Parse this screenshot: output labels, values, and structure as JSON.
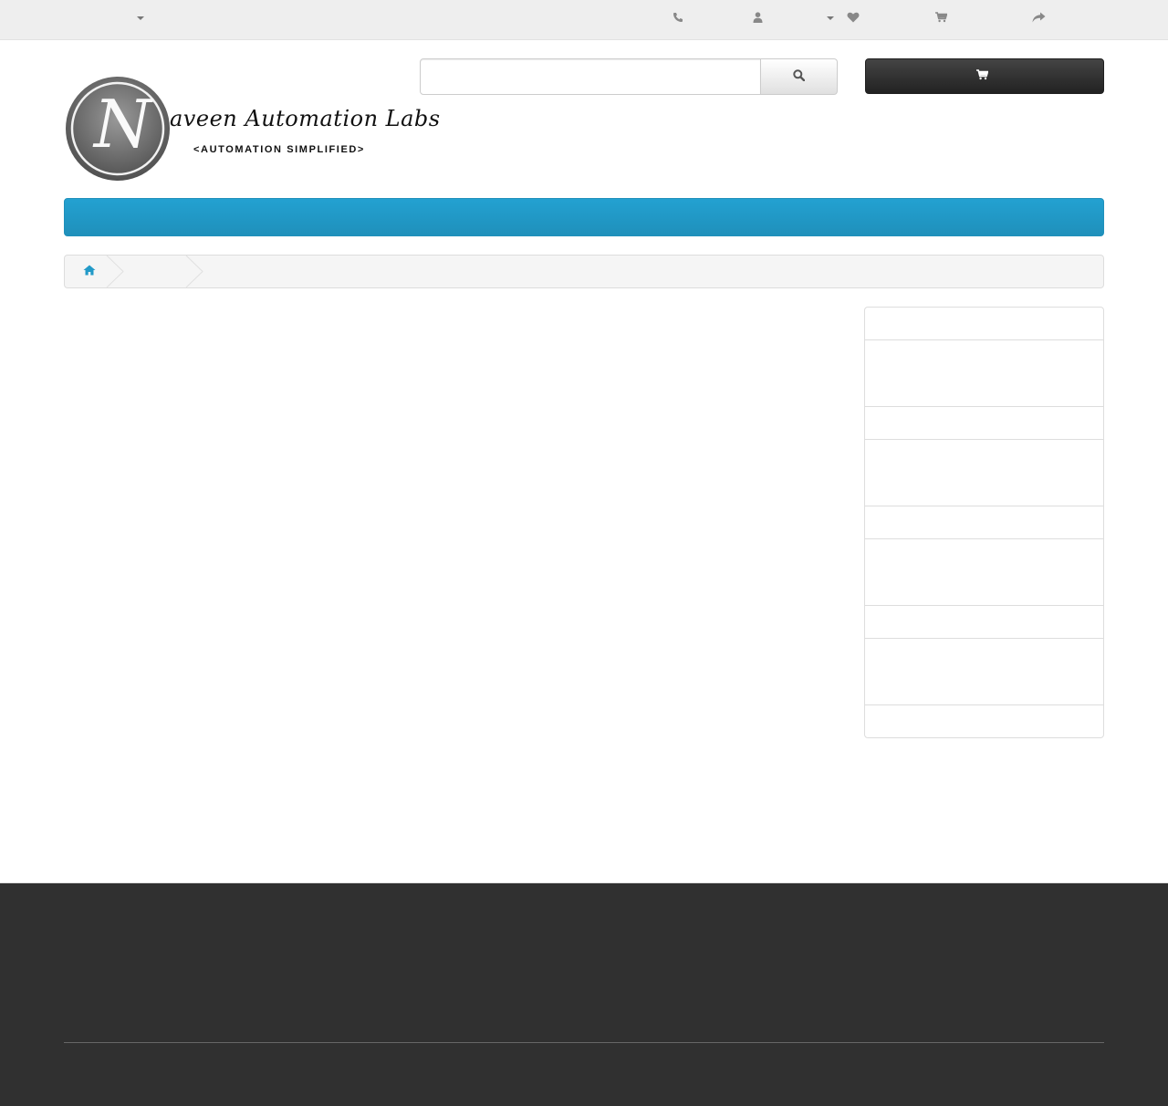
{
  "top_bar": {
    "currency_caret_icon": "caret-down-icon",
    "phone_icon": "phone-icon",
    "account_icon": "user-icon",
    "account_caret_icon": "caret-down-icon",
    "wishlist_icon": "heart-icon",
    "cart_icon": "shopping-cart-icon",
    "checkout_icon": "share-icon"
  },
  "header": {
    "logo": {
      "brand_line": "aveen Automation Labs",
      "initial": "N",
      "tagline": "<AUTOMATION SIMPLIFIED>"
    },
    "search": {
      "value": "",
      "placeholder": "",
      "button_icon": "search-icon"
    },
    "cart": {
      "icon": "shopping-cart-icon",
      "label": ""
    }
  },
  "menu": {
    "color": "#229ac8",
    "items": []
  },
  "breadcrumb": {
    "home_icon": "home-icon",
    "items": [
      "",
      ""
    ]
  },
  "sidebar": {
    "items": [
      "",
      "",
      "",
      "",
      "",
      "",
      "",
      "",
      "",
      "",
      "",
      "",
      ""
    ]
  },
  "footer": {
    "background": "#303030"
  }
}
